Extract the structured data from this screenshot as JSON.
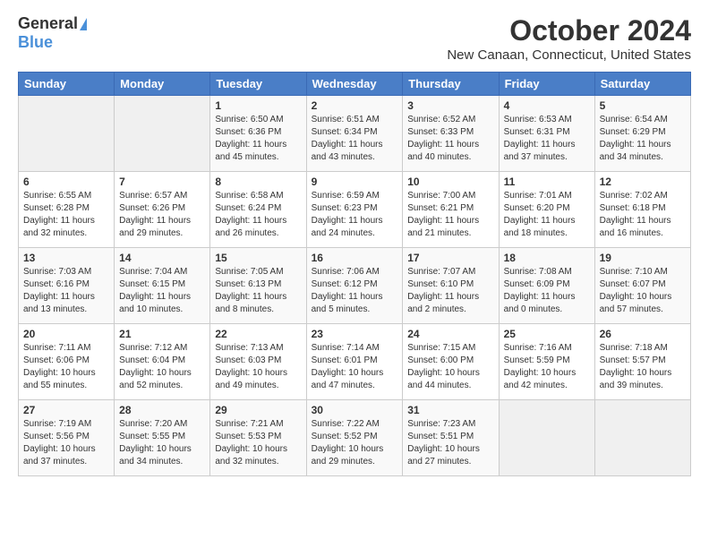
{
  "logo": {
    "general": "General",
    "blue": "Blue"
  },
  "title": "October 2024",
  "subtitle": "New Canaan, Connecticut, United States",
  "days_of_week": [
    "Sunday",
    "Monday",
    "Tuesday",
    "Wednesday",
    "Thursday",
    "Friday",
    "Saturday"
  ],
  "weeks": [
    [
      {
        "day": "",
        "info": ""
      },
      {
        "day": "",
        "info": ""
      },
      {
        "day": "1",
        "info": "Sunrise: 6:50 AM\nSunset: 6:36 PM\nDaylight: 11 hours and 45 minutes."
      },
      {
        "day": "2",
        "info": "Sunrise: 6:51 AM\nSunset: 6:34 PM\nDaylight: 11 hours and 43 minutes."
      },
      {
        "day": "3",
        "info": "Sunrise: 6:52 AM\nSunset: 6:33 PM\nDaylight: 11 hours and 40 minutes."
      },
      {
        "day": "4",
        "info": "Sunrise: 6:53 AM\nSunset: 6:31 PM\nDaylight: 11 hours and 37 minutes."
      },
      {
        "day": "5",
        "info": "Sunrise: 6:54 AM\nSunset: 6:29 PM\nDaylight: 11 hours and 34 minutes."
      }
    ],
    [
      {
        "day": "6",
        "info": "Sunrise: 6:55 AM\nSunset: 6:28 PM\nDaylight: 11 hours and 32 minutes."
      },
      {
        "day": "7",
        "info": "Sunrise: 6:57 AM\nSunset: 6:26 PM\nDaylight: 11 hours and 29 minutes."
      },
      {
        "day": "8",
        "info": "Sunrise: 6:58 AM\nSunset: 6:24 PM\nDaylight: 11 hours and 26 minutes."
      },
      {
        "day": "9",
        "info": "Sunrise: 6:59 AM\nSunset: 6:23 PM\nDaylight: 11 hours and 24 minutes."
      },
      {
        "day": "10",
        "info": "Sunrise: 7:00 AM\nSunset: 6:21 PM\nDaylight: 11 hours and 21 minutes."
      },
      {
        "day": "11",
        "info": "Sunrise: 7:01 AM\nSunset: 6:20 PM\nDaylight: 11 hours and 18 minutes."
      },
      {
        "day": "12",
        "info": "Sunrise: 7:02 AM\nSunset: 6:18 PM\nDaylight: 11 hours and 16 minutes."
      }
    ],
    [
      {
        "day": "13",
        "info": "Sunrise: 7:03 AM\nSunset: 6:16 PM\nDaylight: 11 hours and 13 minutes."
      },
      {
        "day": "14",
        "info": "Sunrise: 7:04 AM\nSunset: 6:15 PM\nDaylight: 11 hours and 10 minutes."
      },
      {
        "day": "15",
        "info": "Sunrise: 7:05 AM\nSunset: 6:13 PM\nDaylight: 11 hours and 8 minutes."
      },
      {
        "day": "16",
        "info": "Sunrise: 7:06 AM\nSunset: 6:12 PM\nDaylight: 11 hours and 5 minutes."
      },
      {
        "day": "17",
        "info": "Sunrise: 7:07 AM\nSunset: 6:10 PM\nDaylight: 11 hours and 2 minutes."
      },
      {
        "day": "18",
        "info": "Sunrise: 7:08 AM\nSunset: 6:09 PM\nDaylight: 11 hours and 0 minutes."
      },
      {
        "day": "19",
        "info": "Sunrise: 7:10 AM\nSunset: 6:07 PM\nDaylight: 10 hours and 57 minutes."
      }
    ],
    [
      {
        "day": "20",
        "info": "Sunrise: 7:11 AM\nSunset: 6:06 PM\nDaylight: 10 hours and 55 minutes."
      },
      {
        "day": "21",
        "info": "Sunrise: 7:12 AM\nSunset: 6:04 PM\nDaylight: 10 hours and 52 minutes."
      },
      {
        "day": "22",
        "info": "Sunrise: 7:13 AM\nSunset: 6:03 PM\nDaylight: 10 hours and 49 minutes."
      },
      {
        "day": "23",
        "info": "Sunrise: 7:14 AM\nSunset: 6:01 PM\nDaylight: 10 hours and 47 minutes."
      },
      {
        "day": "24",
        "info": "Sunrise: 7:15 AM\nSunset: 6:00 PM\nDaylight: 10 hours and 44 minutes."
      },
      {
        "day": "25",
        "info": "Sunrise: 7:16 AM\nSunset: 5:59 PM\nDaylight: 10 hours and 42 minutes."
      },
      {
        "day": "26",
        "info": "Sunrise: 7:18 AM\nSunset: 5:57 PM\nDaylight: 10 hours and 39 minutes."
      }
    ],
    [
      {
        "day": "27",
        "info": "Sunrise: 7:19 AM\nSunset: 5:56 PM\nDaylight: 10 hours and 37 minutes."
      },
      {
        "day": "28",
        "info": "Sunrise: 7:20 AM\nSunset: 5:55 PM\nDaylight: 10 hours and 34 minutes."
      },
      {
        "day": "29",
        "info": "Sunrise: 7:21 AM\nSunset: 5:53 PM\nDaylight: 10 hours and 32 minutes."
      },
      {
        "day": "30",
        "info": "Sunrise: 7:22 AM\nSunset: 5:52 PM\nDaylight: 10 hours and 29 minutes."
      },
      {
        "day": "31",
        "info": "Sunrise: 7:23 AM\nSunset: 5:51 PM\nDaylight: 10 hours and 27 minutes."
      },
      {
        "day": "",
        "info": ""
      },
      {
        "day": "",
        "info": ""
      }
    ]
  ]
}
